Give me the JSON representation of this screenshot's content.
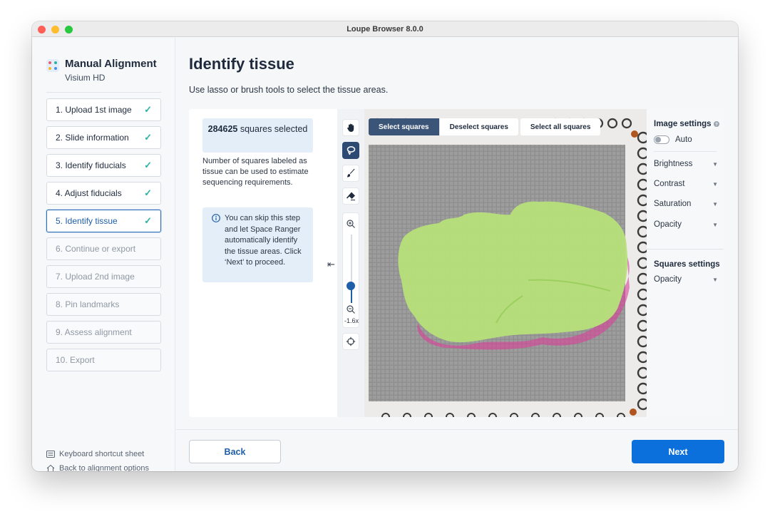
{
  "window": {
    "title": "Loupe Browser 8.0.0"
  },
  "sidebar": {
    "title": "Manual Alignment",
    "subtitle": "Visium HD",
    "steps": [
      {
        "label": "1. Upload 1st image",
        "completed": true
      },
      {
        "label": "2. Slide information",
        "completed": true
      },
      {
        "label": "3. Identify fiducials",
        "completed": true
      },
      {
        "label": "4. Adjust fiducials",
        "completed": true
      },
      {
        "label": "5. Identify tissue",
        "completed": true,
        "active": true
      },
      {
        "label": "6. Continue or export",
        "completed": false
      },
      {
        "label": "7. Upload 2nd image",
        "completed": false
      },
      {
        "label": "8. Pin landmarks",
        "completed": false
      },
      {
        "label": "9. Assess alignment",
        "completed": false
      },
      {
        "label": "10. Export",
        "completed": false
      }
    ],
    "links": {
      "shortcuts": "Keyboard shortcut sheet",
      "back": "Back to alignment options"
    }
  },
  "main": {
    "title": "Identify tissue",
    "subtitle": "Use lasso or brush tools to select the tissue areas.",
    "count_value": "284625",
    "count_label": "squares selected",
    "count_description": "Number of squares labeled as tissue can be used to estimate sequencing requirements.",
    "tip": "You can skip this step and let Space Ranger automatically identify the tissue areas. Click ‘Next’ to proceed."
  },
  "toolbar": {
    "tools": [
      "hand-icon",
      "lasso-icon",
      "brush-icon",
      "eraser-icon"
    ],
    "active_tool": "lasso-icon",
    "zoom_level": "-1.6x",
    "zoom_slider_fraction": 0.25
  },
  "viewer": {
    "segmented": {
      "select": "Select squares",
      "deselect": "Deselect squares"
    },
    "select_all": "Select all squares",
    "selection_color": "#b7e07a",
    "tissue_stain_color": "#d8409a"
  },
  "settings": {
    "image_title": "Image settings",
    "auto_label": "Auto",
    "image_items": [
      "Brightness",
      "Contrast",
      "Saturation",
      "Opacity"
    ],
    "squares_title": "Squares settings",
    "squares_items": [
      "Opacity"
    ]
  },
  "footer": {
    "back": "Back",
    "next": "Next"
  },
  "colors": {
    "primary": "#0b6fdc",
    "check": "#2bb3a0",
    "nav_dark": "#3b5578"
  }
}
